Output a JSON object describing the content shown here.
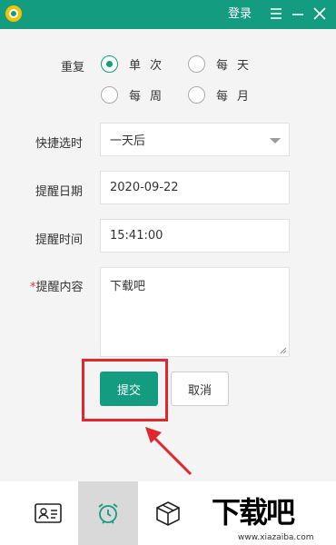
{
  "titlebar": {
    "login_label": "登录",
    "bg_color": "#139c7f"
  },
  "form": {
    "repeat_label": "重复",
    "repeat_options": [
      {
        "label": "单次",
        "checked": true
      },
      {
        "label": "每天",
        "checked": false
      },
      {
        "label": "每周",
        "checked": false
      },
      {
        "label": "每月",
        "checked": false
      }
    ],
    "quick_select_label": "快捷选时",
    "quick_select_value": "一天后",
    "date_label": "提醒日期",
    "date_value": "2020-09-22",
    "time_label": "提醒时间",
    "time_value": "15:41:00",
    "content_required_mark": "*",
    "content_label": "提醒内容",
    "content_value": "下载吧",
    "submit_label": "提交",
    "cancel_label": "取消"
  },
  "bottom_nav": {
    "items": [
      {
        "icon": "contact-card-icon",
        "active": false
      },
      {
        "icon": "alarm-clock-icon",
        "active": true
      },
      {
        "icon": "package-box-icon",
        "active": false
      }
    ]
  },
  "watermark": {
    "logo_text": "下载吧",
    "url_text": "www.xiazaiba.com"
  },
  "colors": {
    "accent": "#139c7f",
    "highlight": "#e2262b"
  }
}
